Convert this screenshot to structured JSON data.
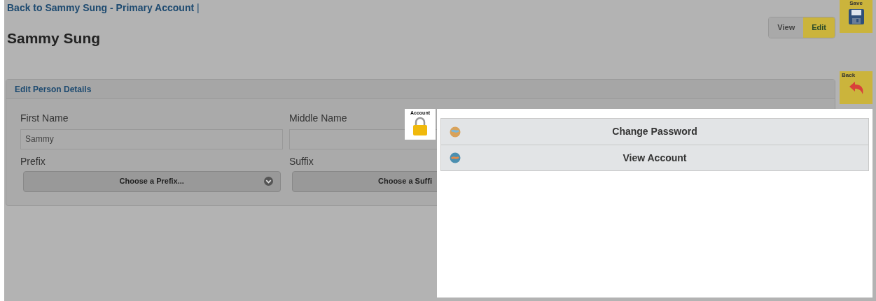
{
  "breadcrumb": {
    "link": "Back to Sammy Sung - Primary Account",
    "separator": "|"
  },
  "title": "Sammy Sung",
  "mode_toggle": [
    {
      "label": "View",
      "selected": false
    },
    {
      "label": "Edit",
      "selected": true
    }
  ],
  "save_button": {
    "label": "Save"
  },
  "back_button": {
    "label": "Back"
  },
  "section": {
    "title": "Edit Person Details",
    "first_name": {
      "label": "First Name",
      "value": "Sammy"
    },
    "middle_name": {
      "label": "Middle Name"
    },
    "prefix": {
      "label": "Prefix",
      "placeholder": "Choose a Prefix..."
    },
    "suffix": {
      "label": "Suffix",
      "placeholder": "Choose a Suffi"
    }
  },
  "account_button": {
    "label": "Account"
  },
  "account_menu": [
    {
      "label": "Change Password"
    },
    {
      "label": "View Account"
    }
  ]
}
